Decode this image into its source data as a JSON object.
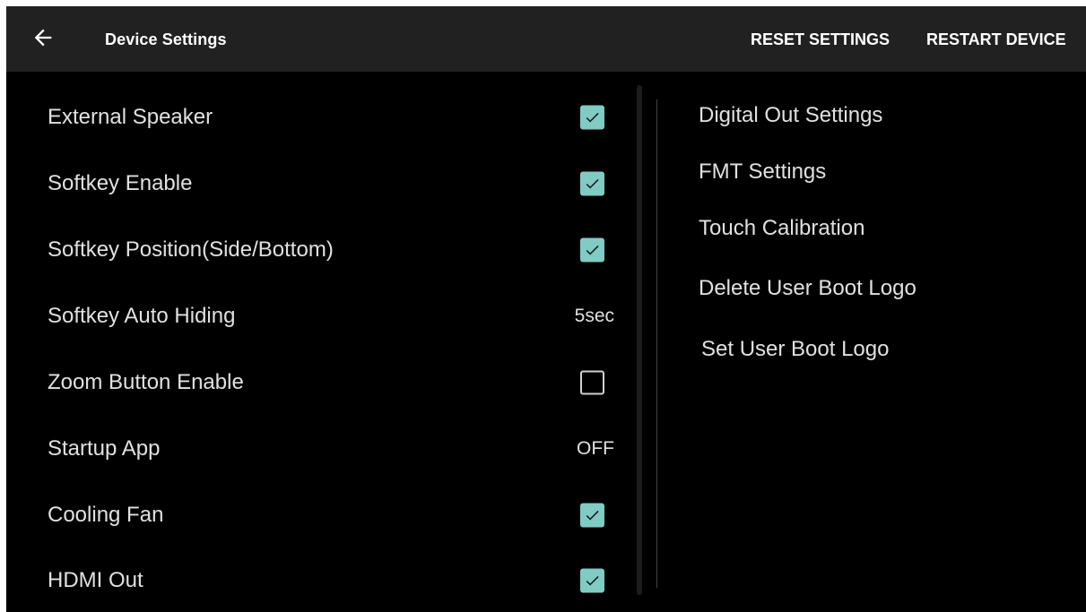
{
  "toolbar": {
    "back_icon": "arrow-left-icon",
    "title": "Device Settings",
    "reset_label": "RESET SETTINGS",
    "restart_label": "RESTART DEVICE"
  },
  "left_settings": [
    {
      "label": "External Speaker",
      "control": "checkbox",
      "checked": true
    },
    {
      "label": "Softkey Enable",
      "control": "checkbox",
      "checked": true
    },
    {
      "label": "Softkey Position(Side/Bottom)",
      "control": "checkbox",
      "checked": true
    },
    {
      "label": "Softkey Auto Hiding",
      "control": "value",
      "value": "5sec"
    },
    {
      "label": "Zoom Button Enable",
      "control": "checkbox",
      "checked": false
    },
    {
      "label": "Startup App",
      "control": "value",
      "value": "OFF"
    },
    {
      "label": "Cooling Fan",
      "control": "checkbox",
      "checked": true
    },
    {
      "label": "HDMI Out",
      "control": "checkbox",
      "checked": true
    }
  ],
  "right_settings": [
    {
      "label": "Digital Out Settings"
    },
    {
      "label": "FMT Settings"
    },
    {
      "label": "Touch Calibration"
    },
    {
      "label": "Delete User Boot Logo"
    },
    {
      "label": "Set User Boot Logo"
    }
  ],
  "colors": {
    "background": "#000000",
    "toolbar": "#212121",
    "accent_checkbox": "#80cbc4",
    "text": "#e0e0e0"
  }
}
